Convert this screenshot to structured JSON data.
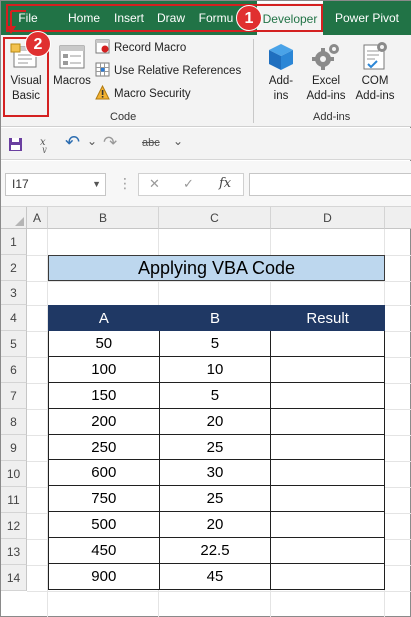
{
  "ribbon": {
    "tabs": [
      "File",
      "Home",
      "Insert",
      "Draw",
      "Formu",
      "Developer",
      "Power Pivot"
    ],
    "active_tab": "Developer",
    "code_group": {
      "label": "Code",
      "visual_basic": [
        "Visual",
        "Basic"
      ],
      "macros": "Macros",
      "record_macro": "Record Macro",
      "relative_refs": "Use Relative References",
      "macro_security": "Macro Security"
    },
    "addins_group": {
      "label": "Add-ins",
      "addins": [
        "Add-",
        "ins"
      ],
      "excel_addins": [
        "Excel",
        "Add-ins"
      ],
      "com_addins": [
        "COM",
        "Add-ins"
      ]
    },
    "annotations": [
      "1",
      "2"
    ]
  },
  "qat": {
    "undo_arrow": "↶",
    "dropdown": "⌄",
    "abc": "abc"
  },
  "formula_bar": {
    "name_box": "I17",
    "cancel": "✕",
    "enter": "✓",
    "fx": "fx",
    "value": ""
  },
  "sheet": {
    "columns": [
      "A",
      "B",
      "C",
      "D"
    ],
    "rows": [
      "1",
      "2",
      "3",
      "4",
      "5",
      "6",
      "7",
      "8",
      "9",
      "10",
      "11",
      "12",
      "13",
      "14"
    ],
    "title": "Applying VBA Code",
    "table_headers": [
      "A",
      "B",
      "Result"
    ],
    "table_rows": [
      [
        "50",
        "5",
        ""
      ],
      [
        "100",
        "10",
        ""
      ],
      [
        "150",
        "5",
        ""
      ],
      [
        "200",
        "20",
        ""
      ],
      [
        "250",
        "25",
        ""
      ],
      [
        "600",
        "30",
        ""
      ],
      [
        "750",
        "25",
        ""
      ],
      [
        "500",
        "20",
        ""
      ],
      [
        "450",
        "22.5",
        ""
      ],
      [
        "900",
        "45",
        ""
      ]
    ]
  },
  "colors": {
    "excel_green": "#217346",
    "header_navy": "#1f3864",
    "title_fill": "#bdd7ee",
    "annotation_red": "#e03030"
  }
}
